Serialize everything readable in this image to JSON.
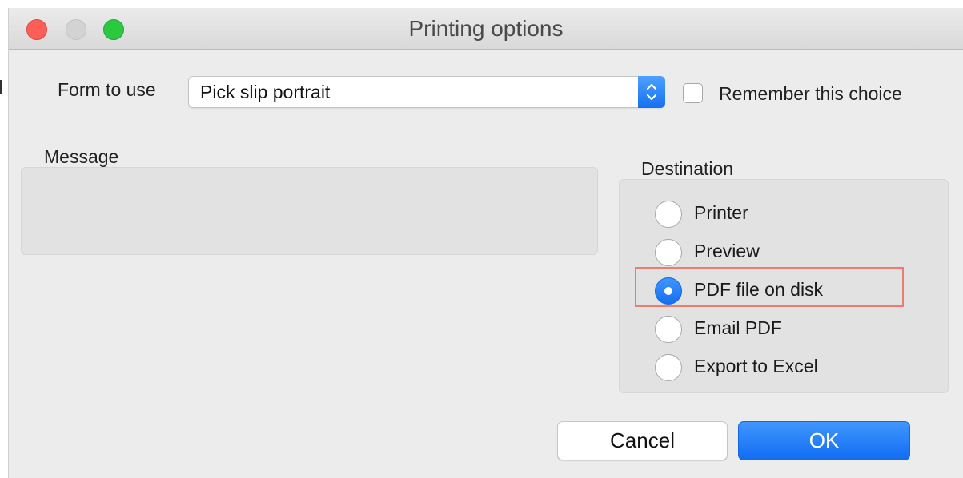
{
  "window": {
    "title": "Printing options"
  },
  "form": {
    "label": "Form to use",
    "selected": "Pick slip portrait",
    "remember_label": "Remember this choice",
    "remember_checked": false
  },
  "message": {
    "label": "Message",
    "value": ""
  },
  "destination": {
    "label": "Destination",
    "selected": "PDF file on disk",
    "options": [
      {
        "label": "Printer",
        "checked": false
      },
      {
        "label": "Preview",
        "checked": false
      },
      {
        "label": "PDF file on disk",
        "checked": true
      },
      {
        "label": "Email PDF",
        "checked": false
      },
      {
        "label": "Export to Excel",
        "checked": false
      }
    ]
  },
  "buttons": {
    "cancel": "Cancel",
    "ok": "OK"
  },
  "colors": {
    "accent": "#1670ef",
    "highlight": "#ef7a6e",
    "close": "#fc5f57",
    "maximize": "#2ac940",
    "minimize_disabled": "#d3d3d3"
  }
}
